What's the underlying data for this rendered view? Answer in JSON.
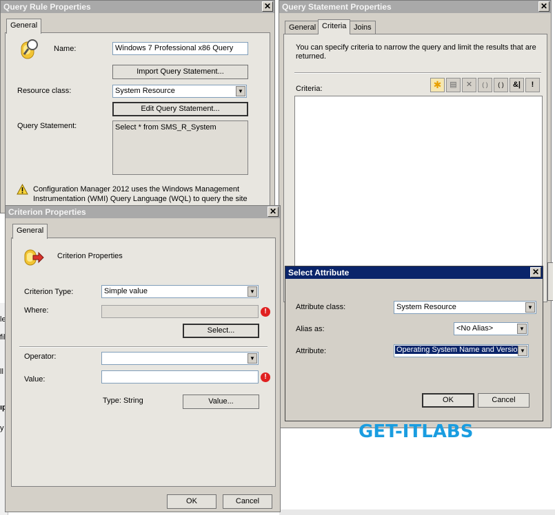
{
  "query_rule": {
    "title": "Query Rule Properties",
    "tab": "General",
    "name_label": "Name:",
    "name_value": "Windows 7 Professional x86 Query",
    "import_button": "Import Query Statement...",
    "resource_class_label": "Resource class:",
    "resource_class_value": "System Resource",
    "edit_button": "Edit Query Statement...",
    "query_statement_label": "Query Statement:",
    "query_statement_value": "Select * from SMS_R_System",
    "warning_text_1": "Configuration Manager 2012 uses the Windows Management",
    "warning_text_2": "Instrumentation (WMI) Query Language (WQL) to query the site"
  },
  "query_statement": {
    "title": "Query Statement Properties",
    "tabs": [
      "General",
      "Criteria",
      "Joins"
    ],
    "description": "You can specify criteria to narrow the query and limit the results that are returned.",
    "criteria_label": "Criteria:",
    "toolbar_glyphs": [
      "✱",
      "▤",
      "✕",
      "( )",
      "( )",
      "&|",
      "!"
    ]
  },
  "criterion": {
    "title": "Criterion Properties",
    "tab": "General",
    "heading": "Criterion Properties",
    "type_label": "Criterion Type:",
    "type_value": "Simple value",
    "where_label": "Where:",
    "select_button": "Select...",
    "operator_label": "Operator:",
    "value_label": "Value:",
    "type_string": "Type: String",
    "value_button": "Value...",
    "ok": "OK",
    "cancel": "Cancel"
  },
  "select_attribute": {
    "title": "Select Attribute",
    "class_label": "Attribute class:",
    "class_value": "System Resource",
    "alias_label": "Alias as:",
    "alias_value": "<No Alias>",
    "attribute_label": "Attribute:",
    "attribute_value": "Operating System Name and Version",
    "ok": "OK",
    "cancel": "Cancel"
  },
  "background_fragments": [
    "le",
    "fil",
    "ll",
    "ıp",
    "y"
  ],
  "watermark": "GET-ITLABS",
  "colors": {
    "watermark": "#1a9de0",
    "active_title": "#0a246a",
    "inactive_title": "#a9a9a9"
  }
}
